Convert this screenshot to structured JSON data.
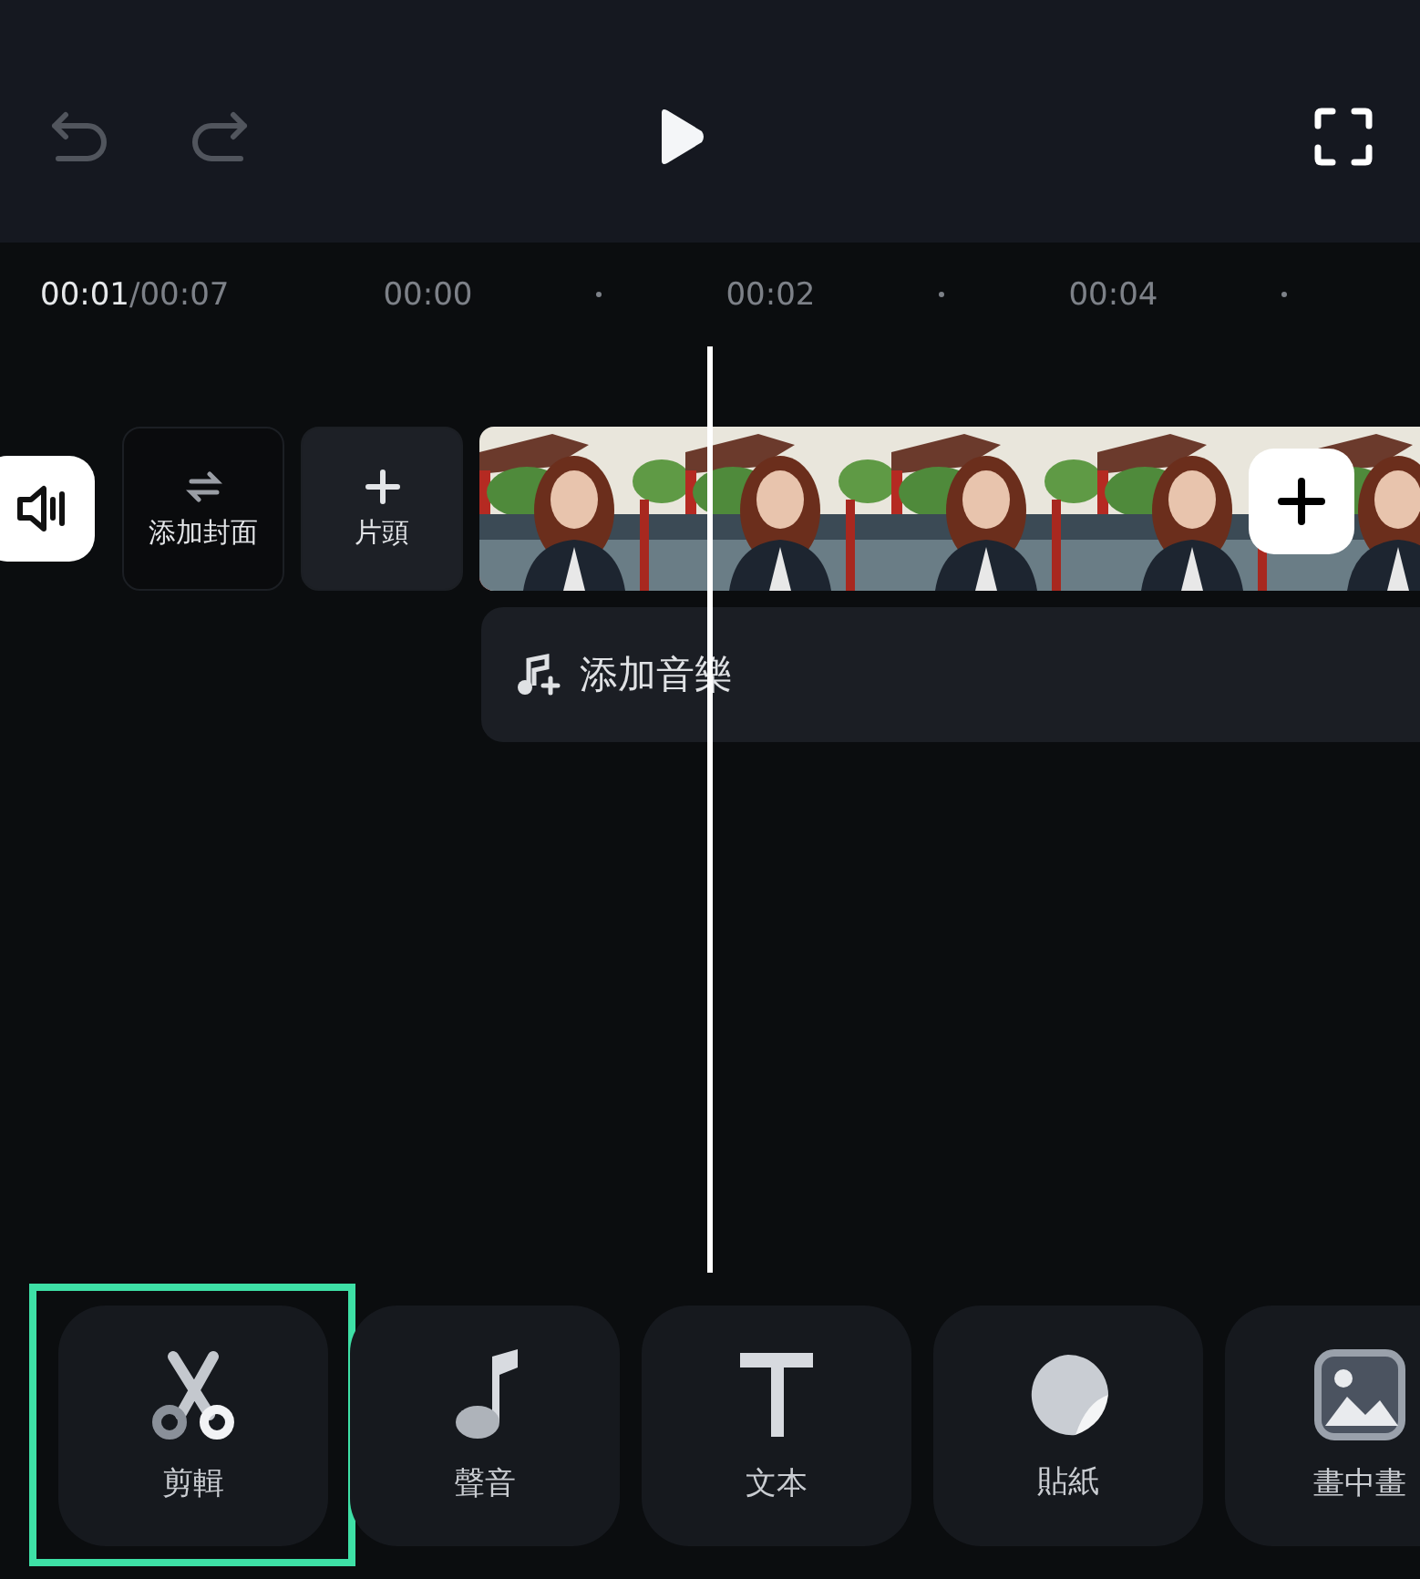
{
  "toolbar": {
    "undo": {
      "disabled": true
    },
    "redo": {
      "disabled": true
    }
  },
  "timeline": {
    "current": "00:01",
    "total": "/00:07",
    "ruler": [
      "00:00",
      "00:02",
      "00:04"
    ]
  },
  "tracks": {
    "cover": {
      "label": "添加封面"
    },
    "intro": {
      "label": "片頭"
    },
    "music": {
      "label": "添加音樂"
    }
  },
  "tools": [
    {
      "kind": "cut",
      "label": "剪輯",
      "selected": true
    },
    {
      "kind": "audio",
      "label": "聲音",
      "selected": false
    },
    {
      "kind": "text",
      "label": "文本",
      "selected": false
    },
    {
      "kind": "sticker",
      "label": "貼紙",
      "selected": false
    },
    {
      "kind": "pip",
      "label": "畫中畫",
      "selected": false
    }
  ]
}
